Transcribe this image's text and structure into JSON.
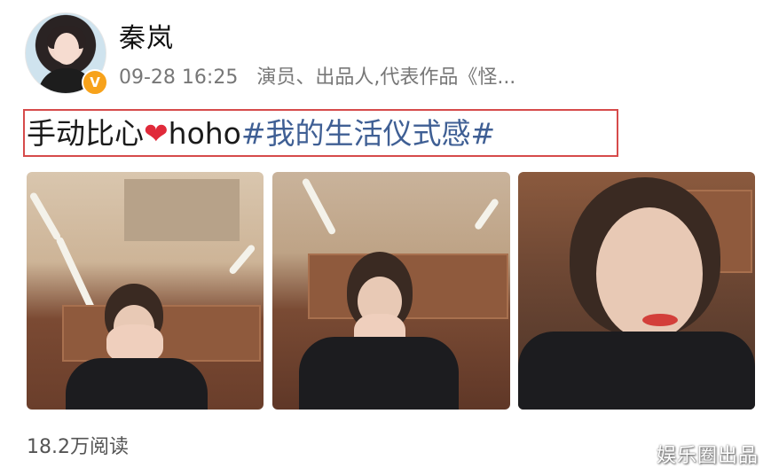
{
  "post": {
    "username": "秦岚",
    "timestamp": "09-28 16:25",
    "description": "演员、出品人,代表作品《怪...",
    "text_prefix": "手动比心",
    "heart": "❤",
    "text_mid": "hoho",
    "hashtag": "#我的生活仪式感#",
    "read_count": "18.2万阅读",
    "verified_badge": "V"
  },
  "watermark": "娱乐圈出品",
  "colors": {
    "hashtag": "#3f5f94",
    "highlight_border": "#d64b4b",
    "badge": "#f7a21b",
    "heart": "#e02a3a"
  },
  "icons": {
    "verified": "verified-badge-icon",
    "heart": "heart-emoji-icon"
  }
}
